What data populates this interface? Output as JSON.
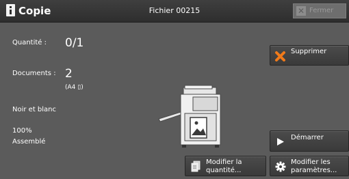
{
  "header": {
    "app_title": "Copie",
    "file_title": "Fichier 00215",
    "close_label": "Fermer",
    "close_icon": "✕"
  },
  "summary": {
    "quantity_label": "Quantité :",
    "quantity_value": "0/1",
    "documents_label": "Documents :",
    "documents_value": "2",
    "documents_format": "(A4 ▯)",
    "color_mode": "Noir et blanc",
    "zoom": "100%",
    "collation": "Assemblé"
  },
  "buttons": {
    "delete_label": "Supprimer",
    "start_label": "Démarrer",
    "modify_quantity_line1": "Modifier la",
    "modify_quantity_line2": "quantité...",
    "modify_settings_line1": "Modifier les",
    "modify_settings_line2": "paramètres..."
  },
  "colors": {
    "background": "#5b5b5b",
    "header": "#333333",
    "delete_accent": "#f07a1a"
  }
}
